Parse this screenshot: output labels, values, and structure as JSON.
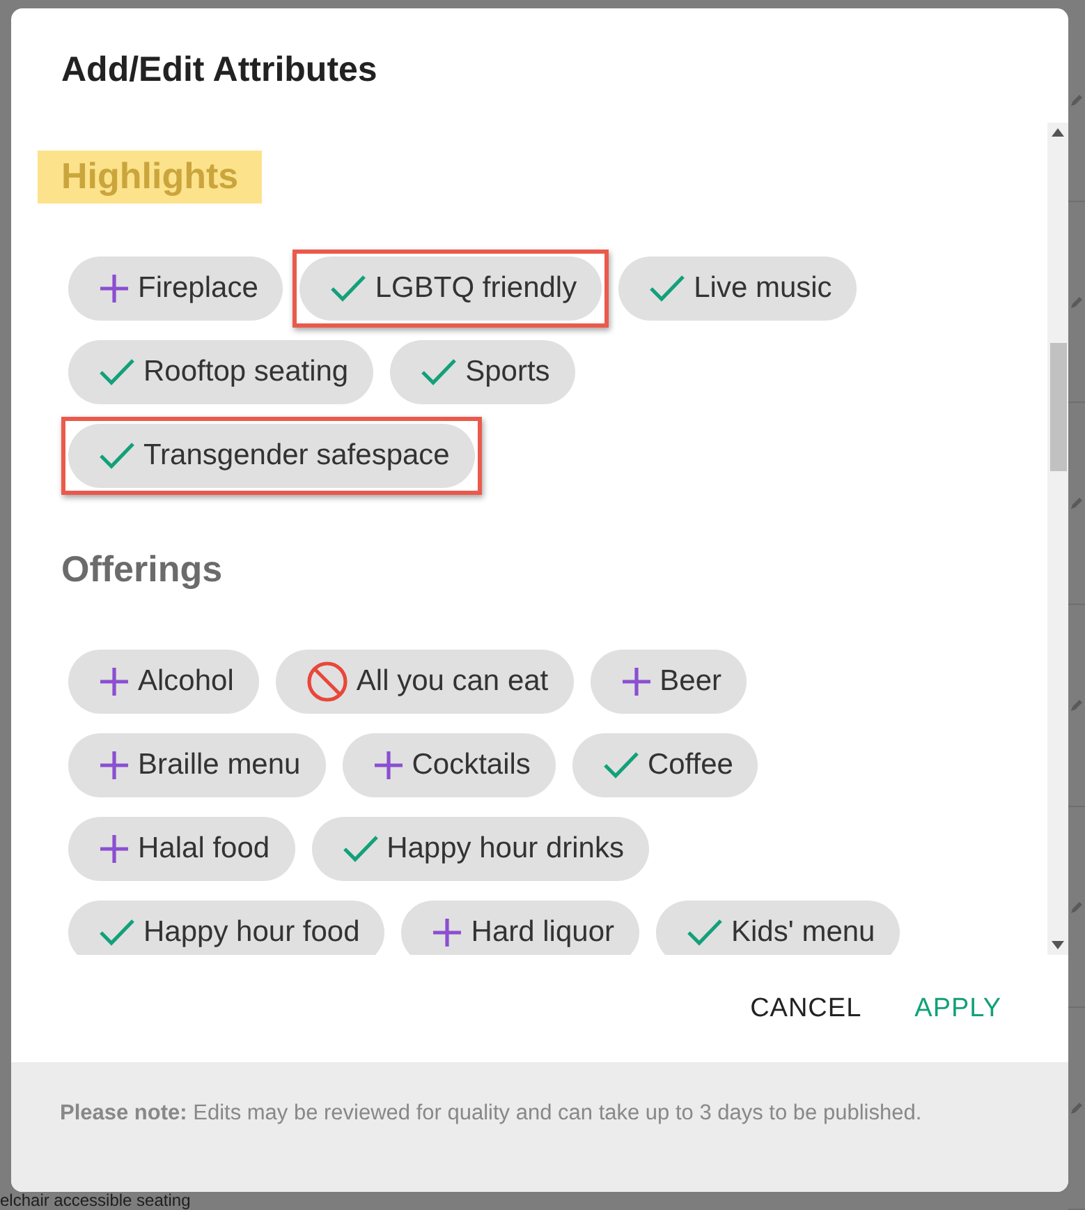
{
  "background": {
    "text": "elchair accessible seating"
  },
  "dialog": {
    "title": "Add/Edit Attributes",
    "sections": [
      {
        "heading": "Highlights",
        "highlighted": true,
        "chips": [
          {
            "label": "Fireplace",
            "kind": "add",
            "flagged": false
          },
          {
            "label": "LGBTQ friendly",
            "kind": "on",
            "flagged": true
          },
          {
            "label": "Live music",
            "kind": "on",
            "flagged": false
          },
          {
            "label": "Rooftop seating",
            "kind": "on",
            "flagged": false
          },
          {
            "label": "Sports",
            "kind": "on",
            "flagged": false
          },
          {
            "label": "Transgender safespace",
            "kind": "on",
            "flagged": true
          }
        ]
      },
      {
        "heading": "Offerings",
        "highlighted": false,
        "chips": [
          {
            "label": "Alcohol",
            "kind": "add",
            "flagged": false
          },
          {
            "label": "All you can eat",
            "kind": "off",
            "flagged": false
          },
          {
            "label": "Beer",
            "kind": "add",
            "flagged": false
          },
          {
            "label": "Braille menu",
            "kind": "add",
            "flagged": false
          },
          {
            "label": "Cocktails",
            "kind": "add",
            "flagged": false
          },
          {
            "label": "Coffee",
            "kind": "on",
            "flagged": false
          },
          {
            "label": "Halal food",
            "kind": "add",
            "flagged": false
          },
          {
            "label": "Happy hour drinks",
            "kind": "on",
            "flagged": false
          },
          {
            "label": "Happy hour food",
            "kind": "on",
            "flagged": false
          },
          {
            "label": "Hard liquor",
            "kind": "add",
            "flagged": false
          },
          {
            "label": "Kids' menu",
            "kind": "on",
            "flagged": false
          }
        ]
      }
    ],
    "buttons": [
      {
        "label": "CANCEL",
        "kind": "secondary"
      },
      {
        "label": "APPLY",
        "kind": "primary"
      }
    ],
    "note": "**Please note:** Edits may be reviewed for quality and can take up to 3 days to be published."
  }
}
